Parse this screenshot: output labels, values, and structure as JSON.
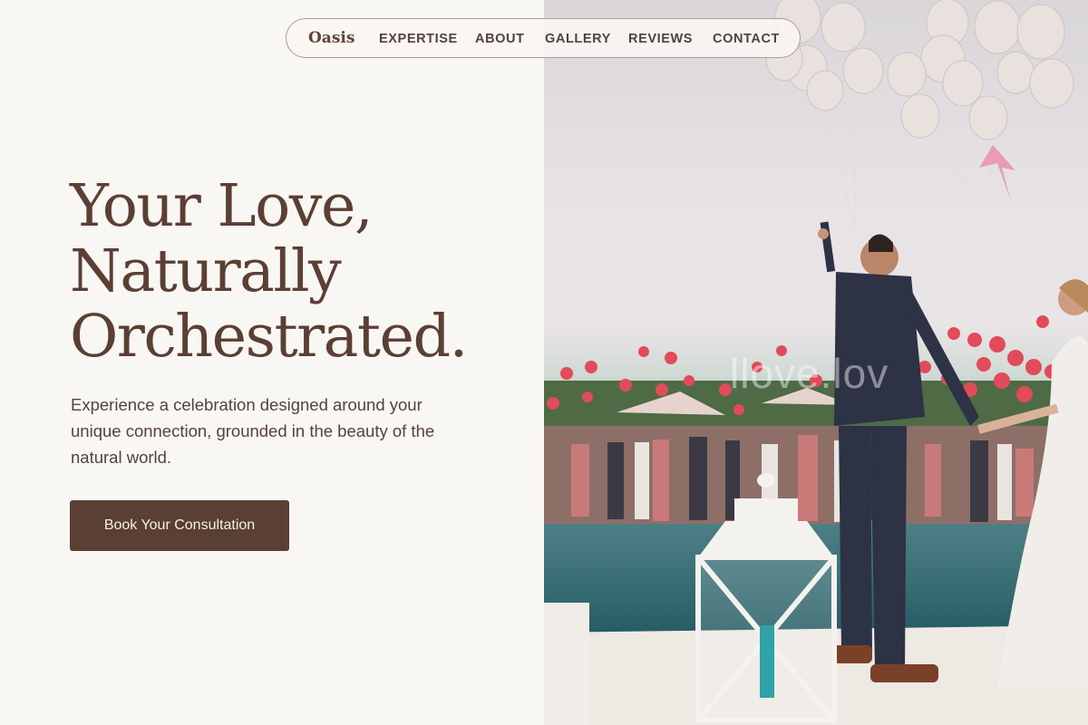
{
  "nav": {
    "logo": "Oasis",
    "links": [
      "EXPERTISE",
      "ABOUT",
      "GALLERY",
      "REVIEWS",
      "CONTACT"
    ]
  },
  "hero": {
    "title_lines": [
      "Your Love,",
      "Naturally",
      "Orchestrated."
    ],
    "subtitle": "Experience a celebration designed around your unique connection, grounded in the beauty of the natural world.",
    "cta_label": "Book Your Consultation"
  },
  "photo": {
    "watermark": "llove.lov"
  },
  "colors": {
    "background": "#f9f7f3",
    "text_brown": "#5b3f34",
    "button_bg": "#5a3f33",
    "nav_border": "#b59792"
  }
}
